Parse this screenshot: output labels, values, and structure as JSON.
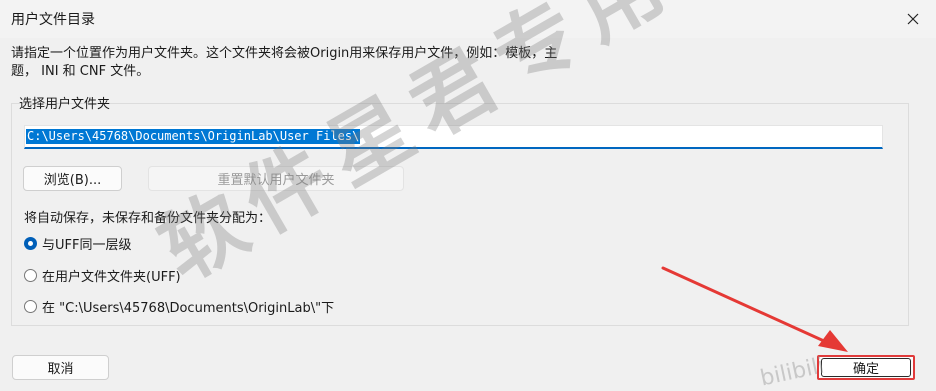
{
  "window": {
    "title": "用户文件目录",
    "close_icon": "close-icon"
  },
  "description": {
    "line1": "请指定一个位置作为用户文件夹。这个文件夹将会被Origin用来保存用户文件，例如：模板，主",
    "line2": "题， INI 和 CNF 文件。"
  },
  "group": {
    "title": "选择用户文件夹",
    "path_value": "C:\\Users\\45768\\Documents\\OriginLab\\User Files\\",
    "browse_label": "浏览(B)...",
    "reset_label": "重置默认用户文件夹",
    "radio_prompt": "将自动保存，未保存和备份文件夹分配为：",
    "options": [
      {
        "label": "与UFF同一层级",
        "checked": true
      },
      {
        "label": "在用户文件文件夹(UFF)",
        "checked": false
      },
      {
        "label": "在 \"C:\\Users\\45768\\Documents\\OriginLab\\\"下",
        "checked": false
      }
    ]
  },
  "footer": {
    "cancel_label": "取消",
    "ok_label": "确定"
  },
  "overlay": {
    "watermark": "软件星君专用",
    "watermark2": "bilibili",
    "arrow_color": "#e53935"
  }
}
